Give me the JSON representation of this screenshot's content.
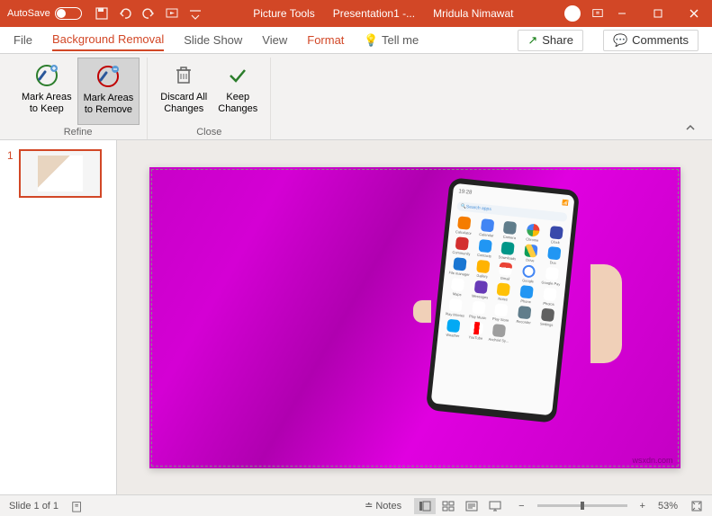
{
  "titlebar": {
    "autosave": "AutoSave",
    "tools_label": "Picture Tools",
    "doc_title": "Presentation1 -...",
    "user": "Mridula Nimawat"
  },
  "tabs": {
    "file": "File",
    "bgremove": "Background Removal",
    "slideshow": "Slide Show",
    "view": "View",
    "format": "Format",
    "tellme": "Tell me",
    "share": "Share",
    "comments": "Comments"
  },
  "ribbon": {
    "mark_keep": "Mark Areas\nto Keep",
    "mark_remove": "Mark Areas\nto Remove",
    "discard": "Discard All\nChanges",
    "keep": "Keep\nChanges",
    "group_refine": "Refine",
    "group_close": "Close"
  },
  "slides": {
    "thumb_num": "1"
  },
  "phone": {
    "time": "19:28",
    "search": "Search apps",
    "apps": [
      {
        "label": "Calculator",
        "color": "#f57c00"
      },
      {
        "label": "Calendar",
        "color": "#4285f4"
      },
      {
        "label": "Camera",
        "color": "#607d8b"
      },
      {
        "label": "Chrome",
        "color": "#fff",
        "ring": true
      },
      {
        "label": "Clock",
        "color": "#3949ab"
      },
      {
        "label": "Community",
        "color": "#d32f2f"
      },
      {
        "label": "Contacts",
        "color": "#2196f3"
      },
      {
        "label": "Downloads",
        "color": "#009688"
      },
      {
        "label": "Drive",
        "color": "#fff",
        "tri": true
      },
      {
        "label": "Duo",
        "color": "#2196f3"
      },
      {
        "label": "File manager",
        "color": "#1976d2"
      },
      {
        "label": "Gallery",
        "color": "#ffb300"
      },
      {
        "label": "Gmail",
        "color": "#fff",
        "env": true
      },
      {
        "label": "Google",
        "color": "#fff",
        "g": true
      },
      {
        "label": "Google Pay",
        "color": "#fff"
      },
      {
        "label": "Maps",
        "color": "#fff"
      },
      {
        "label": "Messages",
        "color": "#673ab7"
      },
      {
        "label": "Notes",
        "color": "#ffc107"
      },
      {
        "label": "Phone",
        "color": "#2196f3"
      },
      {
        "label": "Photos",
        "color": "#fff"
      },
      {
        "label": "Play Movies",
        "color": "#fff"
      },
      {
        "label": "Play Music",
        "color": "#fff"
      },
      {
        "label": "Play Store",
        "color": "#fff"
      },
      {
        "label": "Recorder",
        "color": "#607d8b"
      },
      {
        "label": "Settings",
        "color": "#616161"
      },
      {
        "label": "Weather",
        "color": "#03a9f4"
      },
      {
        "label": "YouTube",
        "color": "#fff",
        "yt": true
      },
      {
        "label": "Android Sy...",
        "color": "#9e9e9e"
      }
    ]
  },
  "watermark": "wsxdn.com",
  "statusbar": {
    "slide_info": "Slide 1 of 1",
    "notes": "Notes",
    "zoom": "53%"
  }
}
